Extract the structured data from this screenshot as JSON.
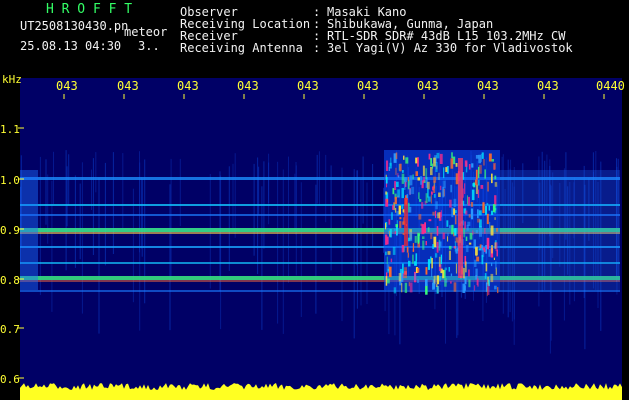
{
  "header": {
    "brand": "H R O F F T",
    "filename": "UT2508130430.pn",
    "tag": "meteor",
    "datetime": "25.08.13 04:30",
    "seconds": "3..",
    "fields": [
      {
        "label": "Observer",
        "sep": ":",
        "value": "Masaki Kano"
      },
      {
        "label": "Receiving Location",
        "sep": ":",
        "value": "Shibukawa, Gunma, Japan"
      },
      {
        "label": "Receiver",
        "sep": ":",
        "value": "RTL-SDR SDR# 43dB L15 103.2MHz CW"
      },
      {
        "label": "Receiving Antenna",
        "sep": ":",
        "value": "3el Yagi(V) Az 330 for Vladivostok"
      }
    ]
  },
  "axis": {
    "unit": "kHz",
    "y_ticks": [
      "1.1",
      "1.0",
      "0.9",
      "0.8",
      "0.7",
      "0.6"
    ],
    "time_ticks": [
      "043",
      "043",
      "043",
      "043",
      "043",
      "043",
      "043",
      "043",
      "043",
      "0440"
    ]
  },
  "colors": {
    "background": "#000000",
    "waterfall_bg": "#000066",
    "label_green": "#33ff66",
    "label_white": "#f2f2f2",
    "tick_yellow": "#ffff33"
  }
}
